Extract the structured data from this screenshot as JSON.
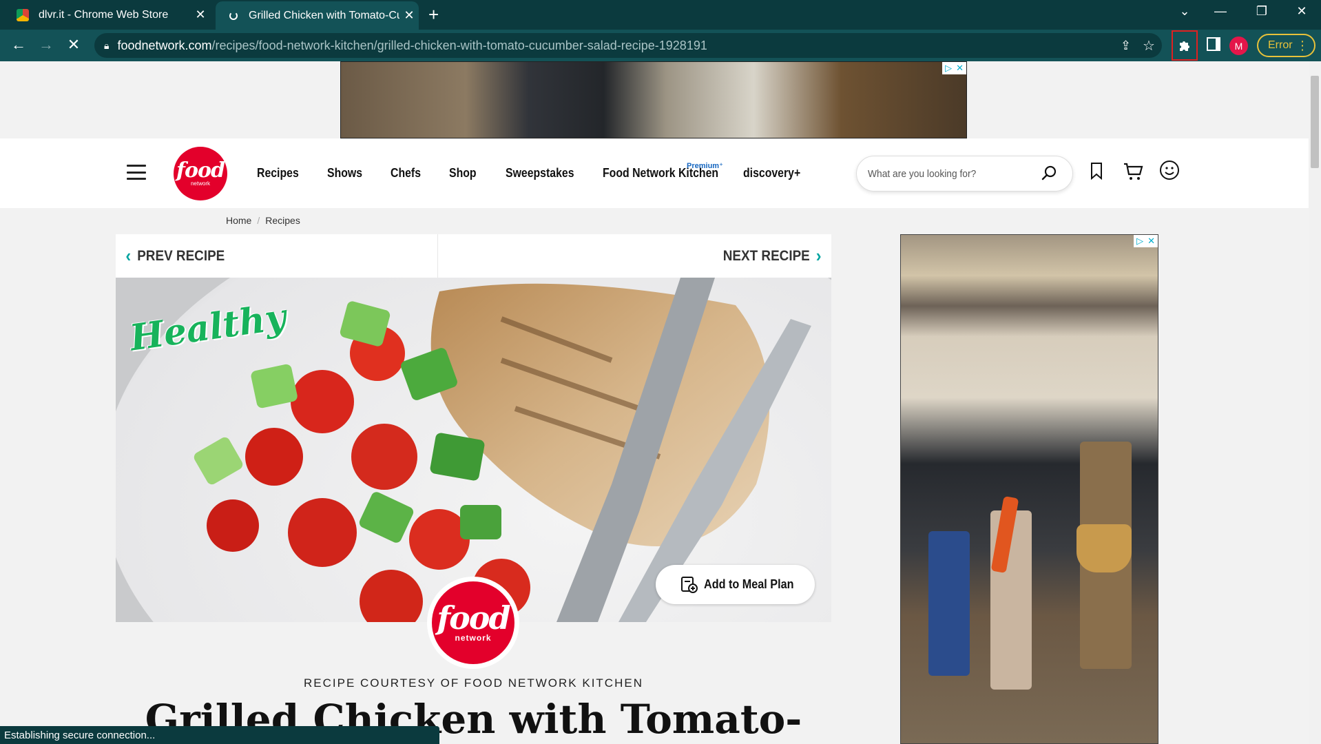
{
  "browser": {
    "tabs": [
      {
        "title": "dlvr.it - Chrome Web Store",
        "close": "✕"
      },
      {
        "title": "Grilled Chicken with Tomato-Cuc",
        "close": "✕"
      }
    ],
    "new_tab": "+",
    "url_host": "foodnetwork.com",
    "url_path": "/recipes/food-network-kitchen/grilled-chicken-with-tomato-cucumber-salad-recipe-1928191",
    "profile_initial": "M",
    "error_label": "Error",
    "status_text": "Establishing secure connection..."
  },
  "header": {
    "logo": {
      "big": "food",
      "small": "network"
    },
    "nav": [
      "Recipes",
      "Shows",
      "Chefs",
      "Shop",
      "Sweepstakes",
      "Food Network Kitchen",
      "discovery+"
    ],
    "premium_tag": "Premium⁺",
    "search_placeholder": "What are you looking for?"
  },
  "breadcrumb": {
    "home": "Home",
    "separator": "/",
    "recipes": "Recipes"
  },
  "recipe": {
    "prev_label": "PREV RECIPE",
    "next_label": "NEXT RECIPE",
    "healthy_tag": "Healthy",
    "meal_plan_label": "Add to Meal Plan",
    "badge": {
      "big": "food",
      "small": "network"
    },
    "courtesy": "RECIPE COURTESY OF FOOD NETWORK KITCHEN",
    "title": "Grilled Chicken with Tomato-"
  },
  "colors": {
    "brand_red": "#e3002b",
    "accent_teal": "#00a4a0",
    "chrome_dark": "#0b3a3e",
    "chrome_toolbar": "#135257"
  }
}
